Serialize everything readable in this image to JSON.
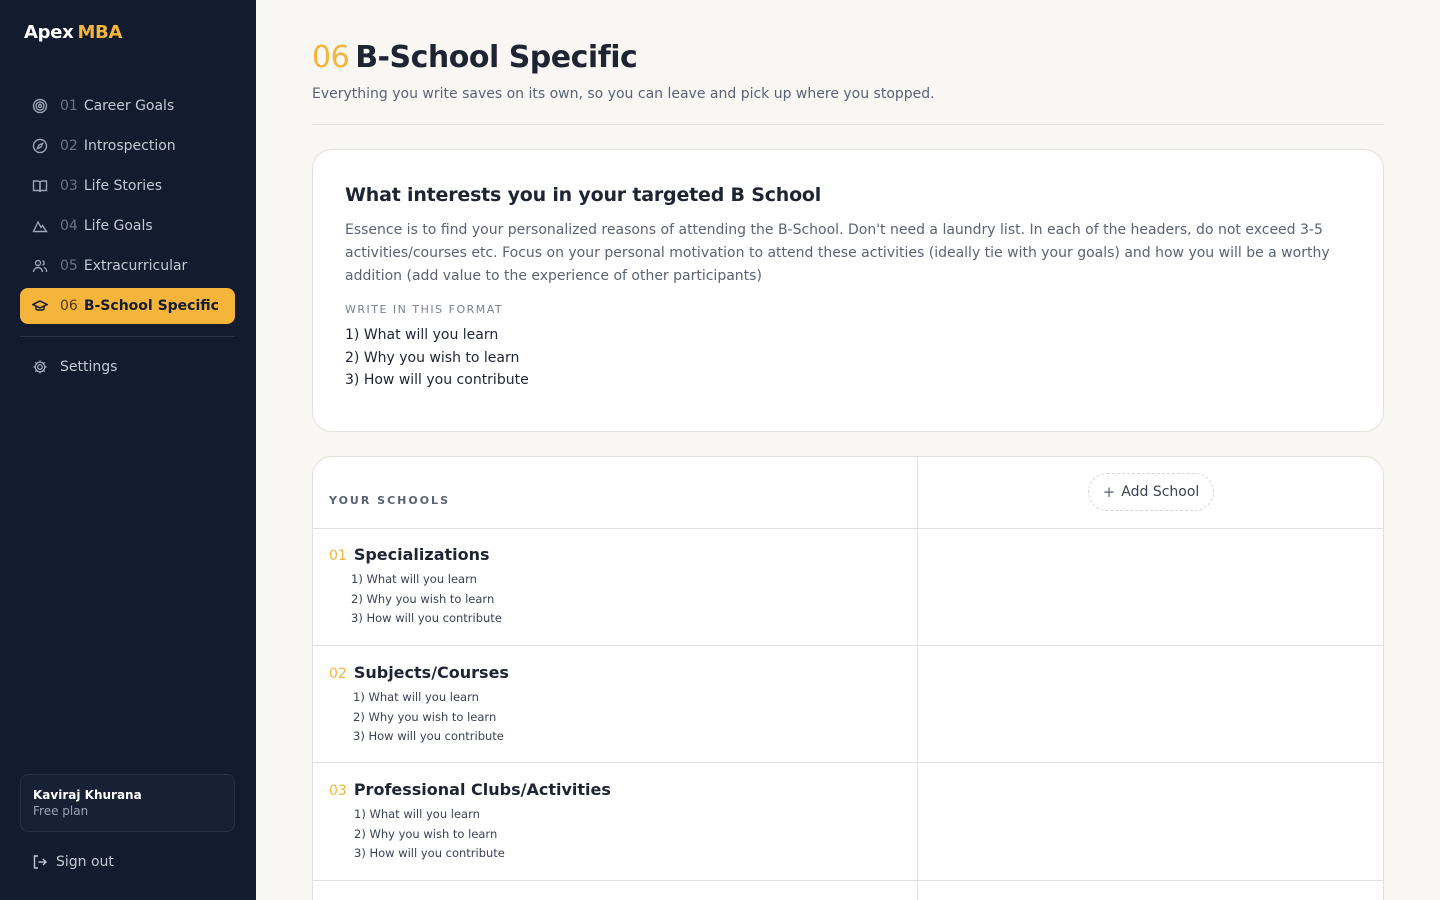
{
  "brand": {
    "part1": "Apex",
    "part2": "MBA"
  },
  "nav": {
    "items": [
      {
        "num": "01",
        "label": "Career Goals",
        "icon": "target-icon"
      },
      {
        "num": "02",
        "label": "Introspection",
        "icon": "compass-icon"
      },
      {
        "num": "03",
        "label": "Life Stories",
        "icon": "book-icon"
      },
      {
        "num": "04",
        "label": "Life Goals",
        "icon": "mountain-icon"
      },
      {
        "num": "05",
        "label": "Extracurricular",
        "icon": "users-icon"
      },
      {
        "num": "06",
        "label": "B-School Specific",
        "icon": "graduation-cap-icon",
        "active": true
      }
    ],
    "settings_label": "Settings"
  },
  "user": {
    "name": "Kaviraj Khurana",
    "plan": "Free plan"
  },
  "signout_label": "Sign out",
  "page": {
    "number": "06",
    "title": "B-School Specific",
    "subtitle": "Everything you write saves on its own, so you can leave and pick up where you stopped."
  },
  "prompt_card": {
    "heading": "What interests you in your targeted B School",
    "description": "Essence is to find your personalized reasons of attending the B-School. Don't need a laundry list. In each of the headers, do not exceed 3-5 activities/courses etc. Focus on your personal motivation to attend these activities (ideally tie with your goals) and how you will be a worthy addition (add value to the experience of other participants)",
    "format_label": "WRITE IN THIS FORMAT",
    "format_lines": [
      "1) What will you learn",
      "2) Why you wish to learn",
      "3) How will you contribute"
    ]
  },
  "schools_table": {
    "header_label": "YOUR SCHOOLS",
    "add_school_label": "Add School",
    "sections": [
      {
        "num": "01",
        "title": "Specializations",
        "lines": [
          "1) What will you learn",
          "2) Why you wish to learn",
          "3) How will you contribute"
        ]
      },
      {
        "num": "02",
        "title": "Subjects/Courses",
        "lines": [
          "1) What will you learn",
          "2) Why you wish to learn",
          "3) How will you contribute"
        ]
      },
      {
        "num": "03",
        "title": "Professional Clubs/Activities",
        "lines": [
          "1) What will you learn",
          "2) Why you wish to learn",
          "3) How will you contribute"
        ]
      }
    ]
  },
  "colors": {
    "accent": "#f5b43a",
    "sidebar_bg": "#131c2e",
    "page_bg": "#f8f7f4"
  }
}
